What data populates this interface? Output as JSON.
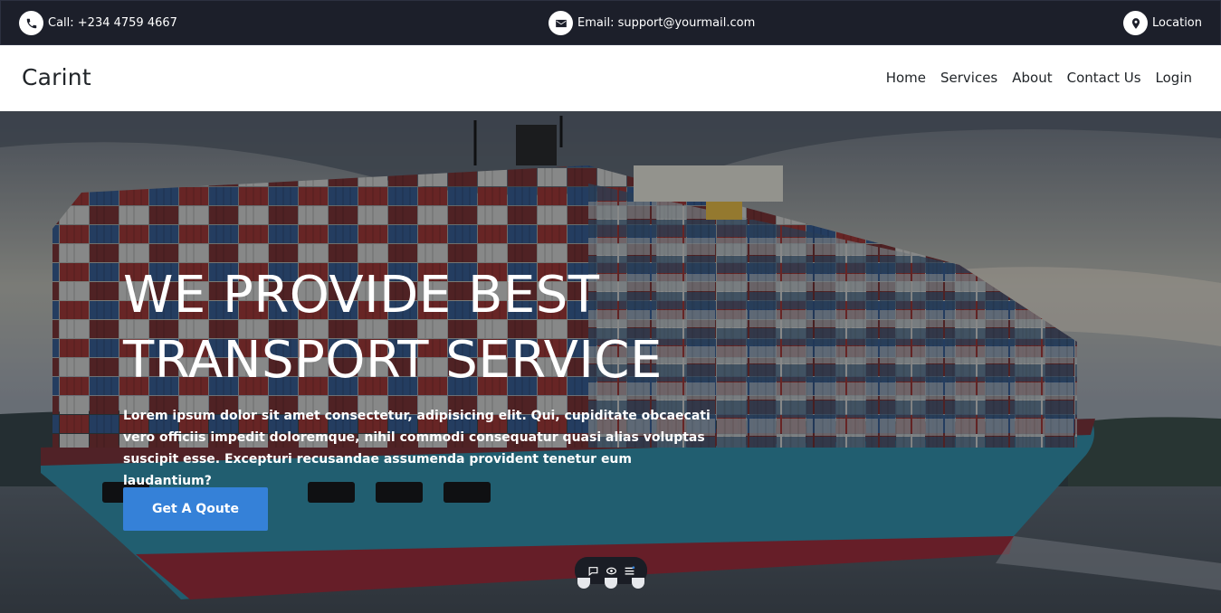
{
  "topbar": {
    "call": "Call: +234 4759 4667",
    "email": "Email: support@yourmail.com",
    "location": "Location"
  },
  "brand": "Carint",
  "nav": [
    "Home",
    "Services",
    "About",
    "Contact Us",
    "Login"
  ],
  "hero": {
    "headline_line1": "WE PROVIDE BEST",
    "headline_line2": "TRANSPORT SERVICE",
    "lead": "Lorem ipsum dolor sit amet consectetur, adipisicing elit. Qui, cupiditate obcaecati vero officiis impedit doloremque, nihil commodi consequatur quasi alias voluptas suscipit esse. Excepturi recusandae assumenda provident tenetur eum laudantium?",
    "cta": "Get A Qoute"
  },
  "colors": {
    "topbar_bg": "#1c1f2a",
    "accent": "#3581d8"
  },
  "icons": [
    "phone-icon",
    "envelope-icon",
    "map-pin-icon",
    "chat-icon",
    "eye-icon",
    "menu-icon"
  ]
}
